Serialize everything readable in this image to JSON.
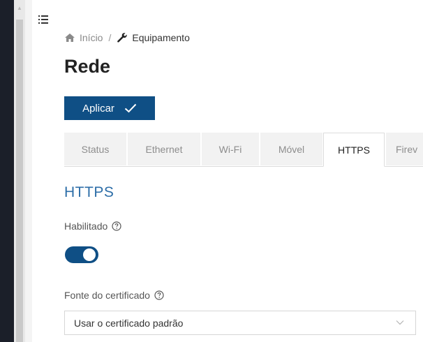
{
  "breadcrumb": {
    "home_icon": "home-icon",
    "home_label": "Início",
    "separator": "/",
    "section_icon": "wrench-icon",
    "current_label": "Equipamento"
  },
  "page": {
    "title": "Rede"
  },
  "toolbar": {
    "apply_label": "Aplicar",
    "apply_icon": "check-icon"
  },
  "tabs": [
    {
      "label": "Status",
      "active": false
    },
    {
      "label": "Ethernet",
      "active": false
    },
    {
      "label": "Wi-Fi",
      "active": false
    },
    {
      "label": "Móvel",
      "active": false
    },
    {
      "label": "HTTPS",
      "active": true
    },
    {
      "label": "Firev",
      "active": false
    }
  ],
  "https": {
    "section_title": "HTTPS",
    "enabled_label": "Habilitado",
    "enabled": true,
    "cert_source_label": "Fonte do certificado",
    "cert_source_value": "Usar o certificado padrão"
  },
  "colors": {
    "accent": "#0f4f85",
    "section_title": "#2d6ea8",
    "sidebar_dark": "#1b1f29"
  }
}
